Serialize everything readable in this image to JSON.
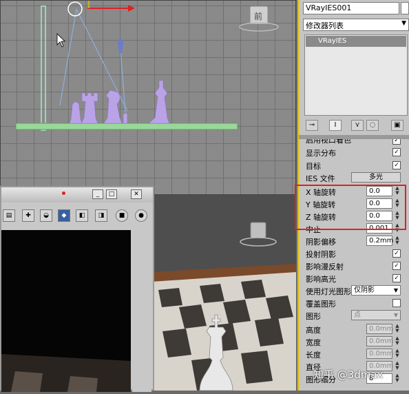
{
  "viewport_top": {
    "view_label": "前"
  },
  "command_panel": {
    "object_name": "VRayIES001",
    "modifier_list": "修改器列表",
    "stack_item": "VRayIES",
    "partial_row": "启用视口着色",
    "rows": [
      {
        "label": "显示分布",
        "type": "check",
        "value": "✓"
      },
      {
        "label": "目标",
        "type": "check",
        "value": "✓"
      },
      {
        "label": "IES 文件",
        "type": "button",
        "value": "多光"
      },
      {
        "label": "X 轴旋转",
        "type": "spin",
        "value": "0.0"
      },
      {
        "label": "Y 轴旋转",
        "type": "spin",
        "value": "0.0"
      },
      {
        "label": "Z 轴旋转",
        "type": "spin",
        "value": "0.0"
      },
      {
        "label": "中止",
        "type": "spin",
        "value": "0.001"
      },
      {
        "label": "阴影偏移",
        "type": "spin",
        "value": "0.2mm"
      },
      {
        "label": "投射阴影",
        "type": "check",
        "value": "✓"
      },
      {
        "label": "影响漫反射",
        "type": "check",
        "value": "✓"
      },
      {
        "label": "影响高光",
        "type": "check",
        "value": "✓"
      },
      {
        "label": "使用灯光图形",
        "type": "select",
        "value": "仅阴影"
      },
      {
        "label": "覆盖图形",
        "type": "check",
        "value": ""
      },
      {
        "label": "图形",
        "type": "select-dis",
        "value": "点"
      },
      {
        "label": "高度",
        "type": "spin-dis",
        "value": "0.0mm"
      },
      {
        "label": "宽度",
        "type": "spin-dis",
        "value": "0.0mm"
      },
      {
        "label": "长度",
        "type": "spin-dis",
        "value": "0.0mm"
      },
      {
        "label": "直径",
        "type": "spin-dis",
        "value": "0.0mm"
      },
      {
        "label": "图形细分",
        "type": "spin",
        "value": "8"
      }
    ]
  },
  "watermark": "知乎 @3dmax",
  "colors": {
    "highlight_border": "#e02020",
    "panel_border": "#e0c000",
    "chess_pieces": "#b9a3e6"
  }
}
